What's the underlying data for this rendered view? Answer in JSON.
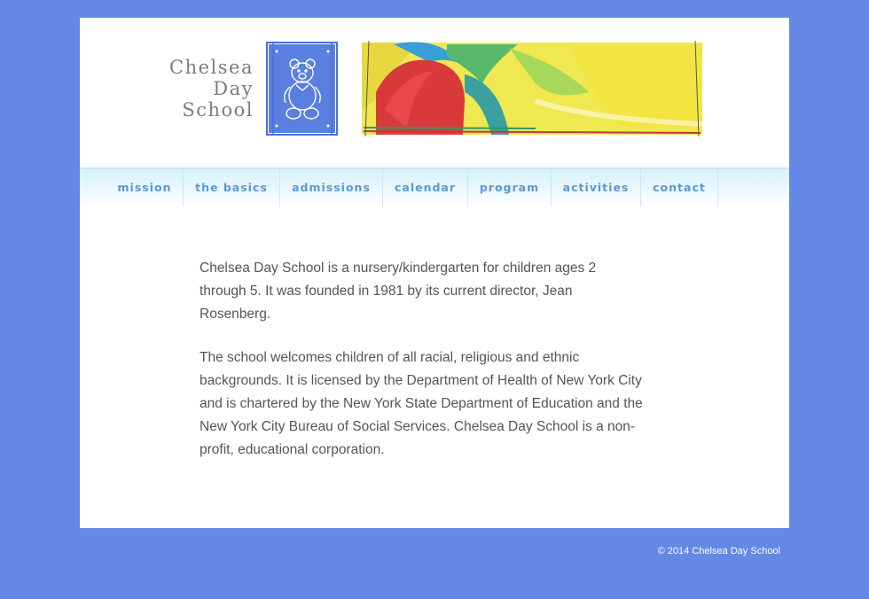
{
  "logo": {
    "line1": "Chelsea",
    "line2": "Day",
    "line3": "School"
  },
  "nav": {
    "items": [
      "mission",
      "the basics",
      "admissions",
      "calendar",
      "program",
      "activities",
      "contact"
    ]
  },
  "content": {
    "paragraphs": [
      "Chelsea Day School is a nursery/kindergarten for children ages 2 through 5. It was founded in 1981 by its current director, Jean Rosenberg.",
      "The school welcomes children of all racial, religious and ethnic backgrounds. It is licensed by the Department of Health of New York City and is chartered by the New York State Department of Education and the New York City Bureau of Social Services. Chelsea Day School is a non-profit, educational corporation."
    ]
  },
  "footer": {
    "copyright": "© 2014 Chelsea Day School"
  },
  "colors": {
    "background": "#6488e4",
    "nav_text": "#5b9ad0",
    "body_text": "#555555",
    "logo_blue": "#5b7fe0"
  }
}
